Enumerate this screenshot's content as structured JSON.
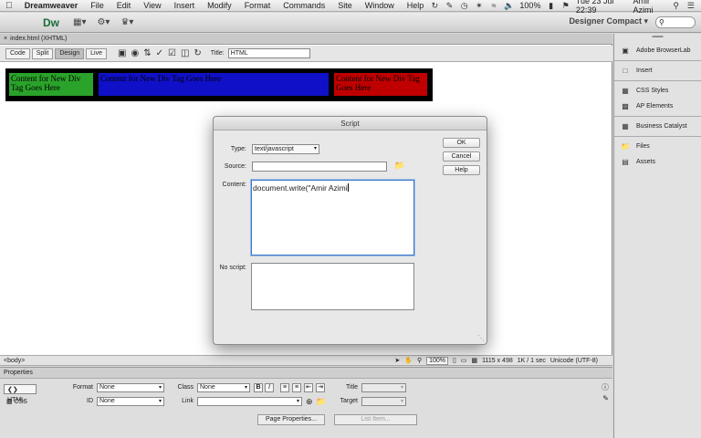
{
  "menubar": {
    "apple": "",
    "items": [
      "Dreamweaver",
      "File",
      "Edit",
      "View",
      "Insert",
      "Modify",
      "Format",
      "Commands",
      "Site",
      "Window",
      "Help"
    ],
    "battery": "100%",
    "datetime": "Tue 23 Jul  22:39",
    "user": "Amir Azimi"
  },
  "appbar": {
    "logo": "Dw",
    "workspace": "Designer Compact"
  },
  "document": {
    "tab": "index.html (XHTML)",
    "views": [
      "Code",
      "Split",
      "Design",
      "Live"
    ],
    "active_view": "Design",
    "title_label": "Title:",
    "title_value": "HTML",
    "div1": "Content for New Div Tag Goes Here",
    "div2": "Content for New Div Tag Goes Here",
    "div3": "Content for New Div Tag Goes Here"
  },
  "statusbar": {
    "tag": "<body>",
    "zoom": "100%",
    "size": "1115 x 498",
    "download": "1K / 1 sec",
    "encoding": "Unicode (UTF-8)"
  },
  "properties": {
    "header": "Properties",
    "html_label": "HTML",
    "css_label": "CSS",
    "format_label": "Format",
    "format_value": "None",
    "id_label": "ID",
    "id_value": "None",
    "class_label": "Class",
    "class_value": "None",
    "link_label": "Link",
    "title_label": "Title",
    "target_label": "Target",
    "bold": "B",
    "italic": "I",
    "page_properties": "Page Properties...",
    "list_item": "List Item..."
  },
  "panel": {
    "items": [
      {
        "label": "Adobe BrowserLab",
        "icon": "browserlab-icon"
      },
      {
        "label": "Insert",
        "icon": "insert-icon"
      },
      {
        "label": "CSS Styles",
        "icon": "css-icon"
      },
      {
        "label": "AP Elements",
        "icon": "ap-icon"
      },
      {
        "label": "Business Catalyst",
        "icon": "bc-icon"
      },
      {
        "label": "Files",
        "icon": "files-icon"
      },
      {
        "label": "Assets",
        "icon": "assets-icon"
      }
    ]
  },
  "dialog": {
    "title": "Script",
    "type_label": "Type:",
    "type_value": "text/javascript",
    "source_label": "Source:",
    "content_label": "Content:",
    "content_value": "document.write(\"Amir Azimi",
    "noscript_label": "No script:",
    "ok": "OK",
    "cancel": "Cancel",
    "help": "Help"
  },
  "colors": {
    "div1": "#2aa32a",
    "div2": "#1010c8",
    "div3": "#c00000"
  }
}
